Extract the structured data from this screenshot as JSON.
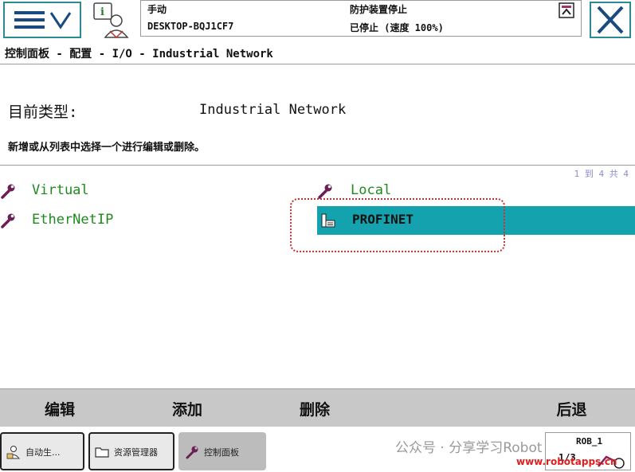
{
  "header": {
    "mode": "手动",
    "controller": "DESKTOP-BQJ1CF7",
    "safety_state": "防护装置停止",
    "run_state": "已停止 (速度 100%)"
  },
  "breadcrumb": "控制面板 - 配置 - I/O - Industrial Network",
  "current_type": {
    "label": "目前类型:",
    "value": "Industrial Network"
  },
  "instruction": "新增或从列表中选择一个进行编辑或删除。",
  "list": {
    "counter": "1 到 4 共 4",
    "items": [
      {
        "label": "Virtual",
        "icon": "wrench-icon",
        "selected": false
      },
      {
        "label": "EtherNetIP",
        "icon": "wrench-icon",
        "selected": false
      },
      {
        "label": "Local",
        "icon": "wrench-icon",
        "selected": false
      },
      {
        "label": "PROFINET",
        "icon": "document-icon",
        "selected": true
      }
    ]
  },
  "commands": {
    "edit": "编辑",
    "add": "添加",
    "delete": "删除",
    "back": "后退"
  },
  "taskbar": [
    {
      "label": "自动生...",
      "icon": "user-icon"
    },
    {
      "label": "资源管理器",
      "icon": "folder-icon"
    },
    {
      "label": "控制面板",
      "icon": "wrench-icon",
      "active": true
    }
  ],
  "watermark": "公众号 · 分享学习Robot",
  "robot": {
    "label": "ROB_1",
    "number": "1/3"
  },
  "site": "www.robotapps.cn",
  "colors": {
    "accent": "#2a8c92",
    "selected": "#14a3ae",
    "item_text": "#1e8a1e",
    "highlight_ring": "#d03030"
  }
}
